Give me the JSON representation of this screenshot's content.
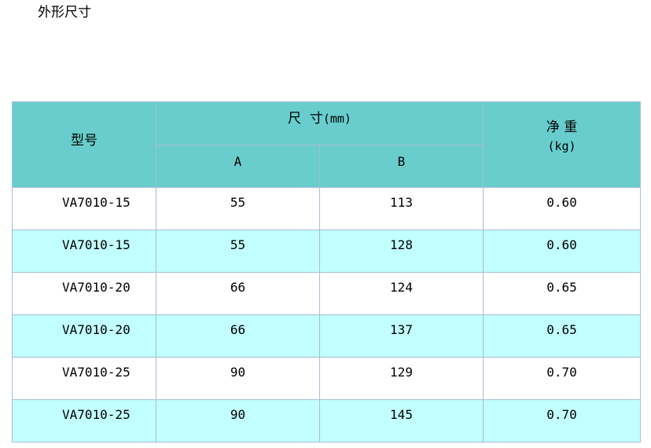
{
  "page_title": "外形尺寸",
  "table": {
    "headers": {
      "model": "型号",
      "dimension": "尺  寸",
      "dimension_unit": "(mm)",
      "col_a": "A",
      "col_b": "B",
      "weight": "净 重",
      "weight_unit": "(kg)"
    },
    "rows": [
      {
        "model": "VA7010-15",
        "a": "55",
        "b": "113",
        "weight": "0.60"
      },
      {
        "model": "VA7010-15",
        "a": "55",
        "b": "128",
        "weight": "0.60"
      },
      {
        "model": "VA7010-20",
        "a": "66",
        "b": "124",
        "weight": "0.65"
      },
      {
        "model": "VA7010-20",
        "a": "66",
        "b": "137",
        "weight": "0.65"
      },
      {
        "model": "VA7010-25",
        "a": "90",
        "b": "129",
        "weight": "0.70"
      },
      {
        "model": "VA7010-25",
        "a": "90",
        "b": "145",
        "weight": "0.70"
      }
    ]
  },
  "colors": {
    "header_bg": "#69cdcd",
    "row_alt_bg": "#c2ffff",
    "border": "#a9bcd6"
  }
}
